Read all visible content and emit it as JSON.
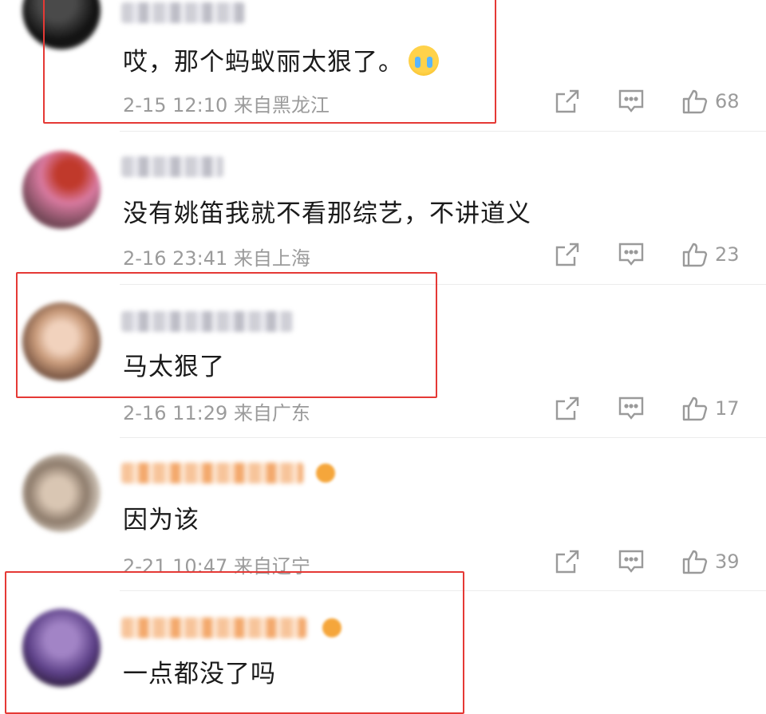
{
  "comments": [
    {
      "text": "哎，那个蚂蚁丽太狠了。",
      "emoji": "crying-face-icon",
      "date": "2-15 12:10",
      "location": "来自黑龙江",
      "likes": "68"
    },
    {
      "text": "没有姚笛我就不看那综艺，不讲道义",
      "date": "2-16 23:41",
      "location": "来自上海",
      "likes": "23"
    },
    {
      "text": "马太狠了",
      "date": "2-16 11:29",
      "location": "来自广东",
      "likes": "17"
    },
    {
      "text": "因为该",
      "date": "2-21 10:47",
      "location": "来自辽宁",
      "likes": "39"
    },
    {
      "text": "一点都没了吗"
    }
  ],
  "colors": {
    "highlight": "#e53935",
    "text": "#1b1b1b",
    "meta": "#9b9b9b"
  },
  "icons": {
    "share": "share-icon",
    "reply": "comment-icon",
    "like": "thumbs-up-icon"
  }
}
